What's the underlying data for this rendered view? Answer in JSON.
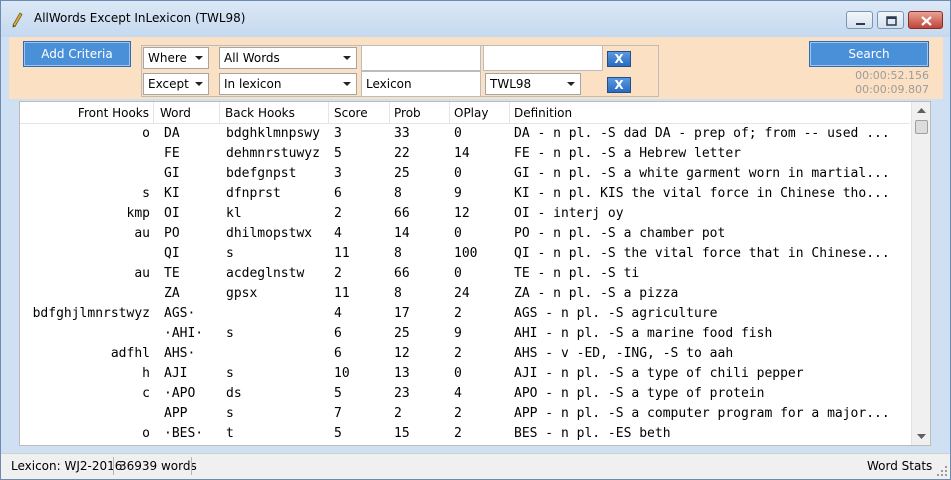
{
  "window": {
    "title": "AllWords Except InLexicon (TWL98)",
    "app_icon": "pencil-icon"
  },
  "criteria": {
    "add_criteria_label": "Add Criteria",
    "search_label": "Search",
    "timer_total": "00:00:52.156",
    "timer_last": "00:00:09.807",
    "rows": [
      {
        "clause": "Where",
        "field": "All Words",
        "value1": "",
        "value2": ""
      },
      {
        "clause": "Except",
        "field": "In lexicon",
        "value1": "Lexicon",
        "value2": "TWL98"
      }
    ],
    "remove_label": "X"
  },
  "grid": {
    "columns": [
      "Front Hooks",
      "Word",
      "Back Hooks",
      "Score",
      "Prob",
      "OPlay",
      "Definition"
    ],
    "rows": [
      {
        "front": "o",
        "word": "DA",
        "back": "bdghklmnpswy",
        "score": "3",
        "prob": "33",
        "oplay": "0",
        "def": "DA - n pl. -S dad DA - prep of; from -- used ..."
      },
      {
        "front": "",
        "word": "FE",
        "back": "dehmnrstuwyz",
        "score": "5",
        "prob": "22",
        "oplay": "14",
        "def": "FE - n pl. -S a Hebrew letter"
      },
      {
        "front": "",
        "word": "GI",
        "back": "bdefgnpst",
        "score": "3",
        "prob": "25",
        "oplay": "0",
        "def": "GI - n pl. -S a white garment worn in martial..."
      },
      {
        "front": "s",
        "word": "KI",
        "back": "dfnprst",
        "score": "6",
        "prob": "8",
        "oplay": "9",
        "def": "KI - n pl. KIS the vital force in Chinese tho..."
      },
      {
        "front": "kmp",
        "word": "OI",
        "back": "kl",
        "score": "2",
        "prob": "66",
        "oplay": "12",
        "def": "OI - interj oy"
      },
      {
        "front": "au",
        "word": "PO",
        "back": "dhilmopstwx",
        "score": "4",
        "prob": "14",
        "oplay": "0",
        "def": "PO - n pl. -S a chamber pot"
      },
      {
        "front": "",
        "word": "QI",
        "back": "s",
        "score": "11",
        "prob": "8",
        "oplay": "100",
        "def": "QI - n pl. -S the vital force that in Chinese..."
      },
      {
        "front": "au",
        "word": "TE",
        "back": "acdeglnstw",
        "score": "2",
        "prob": "66",
        "oplay": "0",
        "def": "TE - n pl. -S ti"
      },
      {
        "front": "",
        "word": "ZA",
        "back": "gpsx",
        "score": "11",
        "prob": "8",
        "oplay": "24",
        "def": "ZA - n pl. -S a pizza"
      },
      {
        "front": "bdfghjlmnrstwyz",
        "word": "AGS·",
        "back": "",
        "score": "4",
        "prob": "17",
        "oplay": "2",
        "def": "AGS - n pl. -S agriculture"
      },
      {
        "front": "",
        "word": "·AHI·",
        "back": "s",
        "score": "6",
        "prob": "25",
        "oplay": "9",
        "def": "AHI - n pl. -S a marine food fish"
      },
      {
        "front": "adfhl",
        "word": "AHS·",
        "back": "",
        "score": "6",
        "prob": "12",
        "oplay": "2",
        "def": "AHS - v -ED, -ING, -S to aah"
      },
      {
        "front": "h",
        "word": "AJI",
        "back": "s",
        "score": "10",
        "prob": "13",
        "oplay": "0",
        "def": "AJI - n pl. -S a type of chili pepper"
      },
      {
        "front": "c",
        "word": "·APO",
        "back": "ds",
        "score": "5",
        "prob": "23",
        "oplay": "4",
        "def": "APO - n pl. -S a type of protein"
      },
      {
        "front": "",
        "word": "APP",
        "back": "s",
        "score": "7",
        "prob": "2",
        "oplay": "2",
        "def": "APP - n pl. -S a computer program for a major..."
      },
      {
        "front": "o",
        "word": "·BES·",
        "back": "t",
        "score": "5",
        "prob": "15",
        "oplay": "2",
        "def": "BES - n pl. -ES beth"
      }
    ]
  },
  "status": {
    "lexicon": "Lexicon: WJ2-2016",
    "word_count": "36939 words",
    "word_stats": "Word Stats"
  }
}
